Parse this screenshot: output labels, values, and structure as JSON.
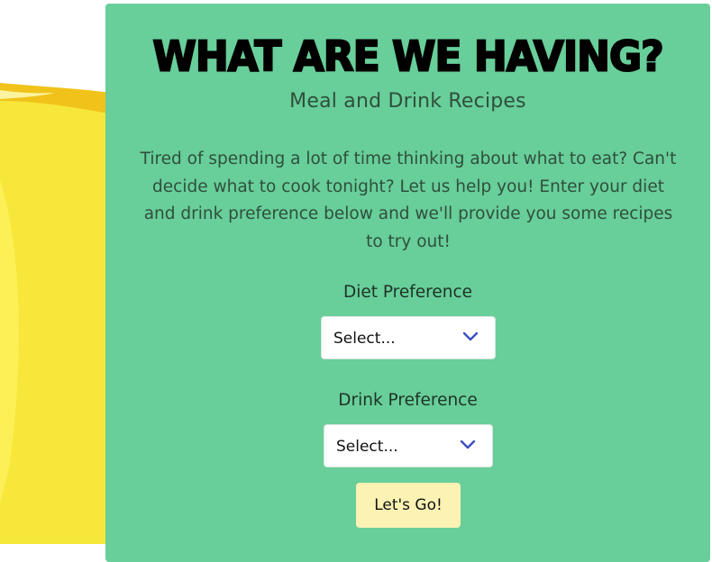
{
  "header": {
    "title": "WHAT ARE WE HAVING?",
    "subtitle": "Meal and Drink Recipes"
  },
  "intro": {
    "text": "Tired of spending a lot of time thinking about what to eat? Can't decide what to cook tonight? Let us help you! Enter your diet and drink preference below and we'll provide you some recipes to try out!"
  },
  "form": {
    "diet": {
      "label": "Diet Preference",
      "selected": "Select..."
    },
    "drink": {
      "label": "Drink Preference",
      "selected": "Select..."
    },
    "submit_label": "Let's Go!"
  },
  "icons": {
    "dropdown": "chevron-down-icon"
  },
  "colors": {
    "card_background": "#68ce9a",
    "button_background": "#fbf2b4",
    "chevron": "#3a4ec0",
    "background_yellow": "#f7e73a",
    "background_gold": "#f1c31a"
  }
}
